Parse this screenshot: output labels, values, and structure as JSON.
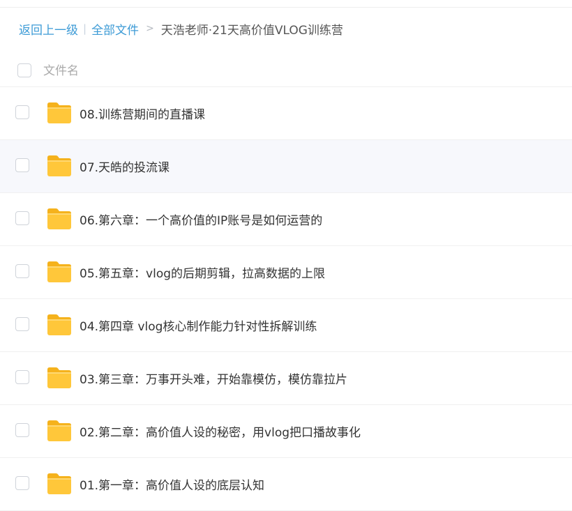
{
  "breadcrumb": {
    "back_label": "返回上一级",
    "separator": "|",
    "all_files_label": "全部文件",
    "arrow": ">",
    "current_folder": "天浩老师·21天高价值VLOG训练营"
  },
  "header": {
    "column_label": "文件名"
  },
  "files": [
    {
      "name": "08.训练营期间的直播课",
      "icon": "folder-icon"
    },
    {
      "name": "07.天皓的投流课",
      "icon": "folder-icon",
      "hovered": true
    },
    {
      "name": "06.第六章：一个高价值的IP账号是如何运营的",
      "icon": "folder-icon"
    },
    {
      "name": "05.第五章：vlog的后期剪辑，拉高数据的上限",
      "icon": "folder-icon"
    },
    {
      "name": "04.第四章 vlog核心制作能力针对性拆解训练",
      "icon": "folder-icon"
    },
    {
      "name": "03.第三章：万事开头难，开始靠模仿，模仿靠拉片",
      "icon": "folder-icon"
    },
    {
      "name": "02.第二章：高价值人设的秘密，用vlog把口播故事化",
      "icon": "folder-icon"
    },
    {
      "name": "01.第一章：高价值人设的底层认知",
      "icon": "folder-icon"
    }
  ],
  "colors": {
    "link": "#3d9bd6",
    "folder": "#ffc73a",
    "hover_row": "#f7f8fc"
  }
}
